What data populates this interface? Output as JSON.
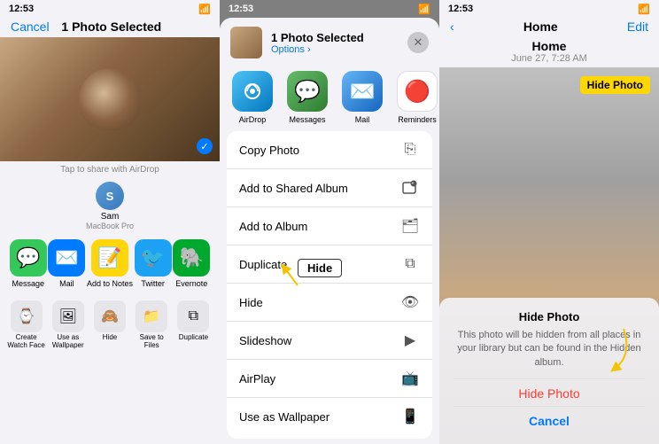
{
  "panel1": {
    "status_time": "12:53",
    "nav_cancel": "Cancel",
    "nav_title": "1 Photo Selected",
    "share_hint": "Tap to share with AirDrop",
    "contact_name": "Sam",
    "contact_device": "MacBook Pro",
    "apps": [
      {
        "label": "Message",
        "icon": "💬",
        "bg": "#34c759"
      },
      {
        "label": "Mail",
        "icon": "✉️",
        "bg": "#007aff"
      },
      {
        "label": "Add to Notes",
        "icon": "📝",
        "bg": "#ffd60a"
      },
      {
        "label": "Twitter",
        "icon": "🐦",
        "bg": "#1da1f2"
      },
      {
        "label": "Evernote",
        "icon": "🐘",
        "bg": "#00a82d"
      }
    ],
    "bottom_actions": [
      {
        "label": "Create Watch Face",
        "icon": "⌚"
      },
      {
        "label": "Use as Wallpaper",
        "icon": "🖼"
      },
      {
        "label": "Hide",
        "icon": "🙈"
      },
      {
        "label": "Save to Files",
        "icon": "📁"
      },
      {
        "label": "Duplicate",
        "icon": "⧉"
      }
    ]
  },
  "panel2": {
    "status_time": "12:53",
    "sheet_title": "1 Photo Selected",
    "sheet_options": "Options ›",
    "close_icon": "✕",
    "apps": [
      {
        "label": "AirDrop",
        "icon": "📡",
        "bg_class": "airdrop-icon-bg"
      },
      {
        "label": "Messages",
        "icon": "💬",
        "bg_class": "messages-icon-bg"
      },
      {
        "label": "Mail",
        "icon": "✉️",
        "bg_class": "mail-icon-bg"
      },
      {
        "label": "Reminders",
        "icon": "🔴",
        "bg_class": "reminders-icon-bg"
      }
    ],
    "actions": [
      {
        "label": "Copy Photo",
        "icon": "⎘"
      },
      {
        "label": "Add to Shared Album",
        "icon": "👥"
      },
      {
        "label": "Add to Album",
        "icon": "🗂"
      },
      {
        "label": "Duplicate",
        "icon": "⧉"
      },
      {
        "label": "Hide",
        "icon": "👁"
      },
      {
        "label": "Slideshow",
        "icon": "▶"
      },
      {
        "label": "AirPlay",
        "icon": "📺"
      },
      {
        "label": "Use as Wallpaper",
        "icon": "📱"
      }
    ],
    "annotation_hide": "Hide",
    "annotation_hide_label": "Hide"
  },
  "panel3": {
    "status_time": "12:53",
    "nav_back": "‹",
    "nav_title": "Home",
    "nav_edit": "Edit",
    "album_title": "Home",
    "album_date": "June 27, 7:28 AM",
    "dialog": {
      "title": "Hide Photo",
      "text": "This photo will be hidden from all places in your library but can be found in the Hidden album.",
      "hide_btn": "Hide Photo",
      "cancel_btn": "Cancel"
    },
    "annotation": "Hide Photo"
  }
}
